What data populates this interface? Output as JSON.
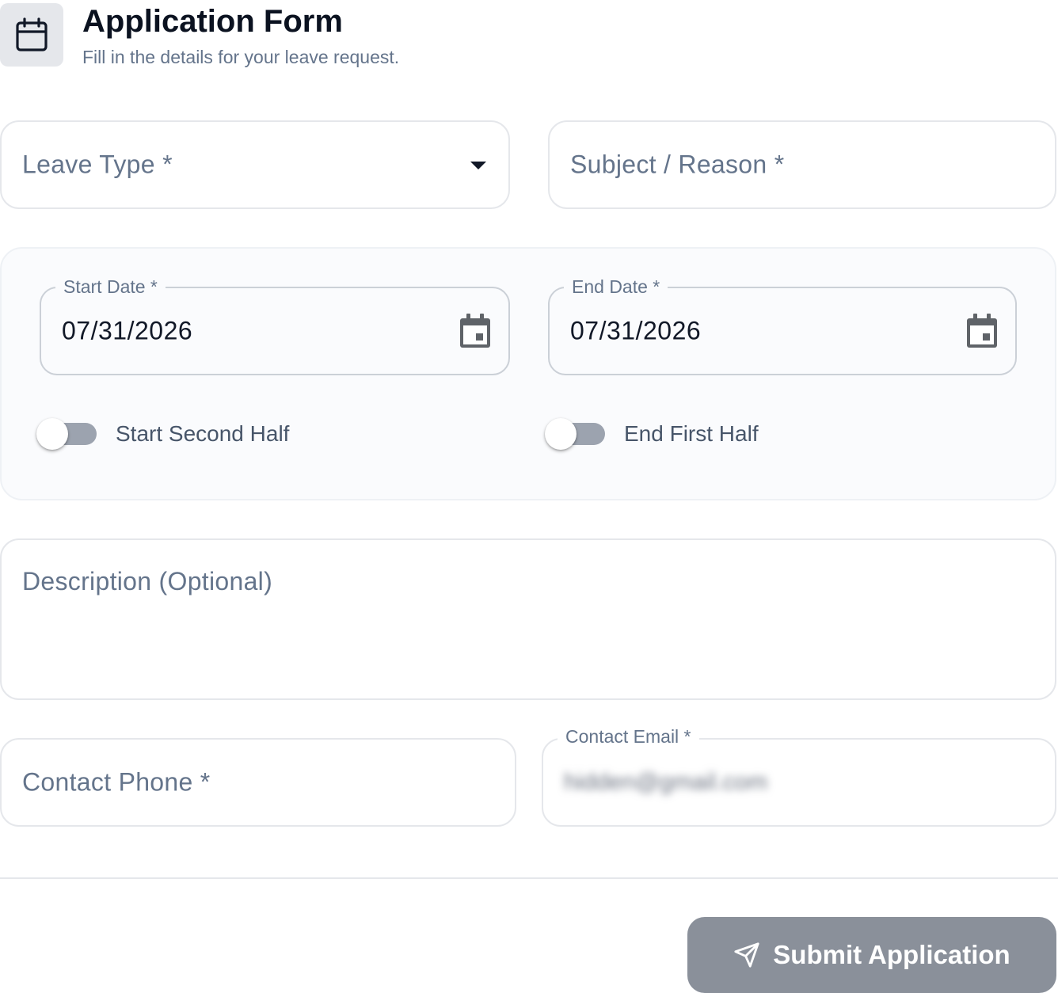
{
  "header": {
    "icon": "calendar-icon",
    "title": "Application Form",
    "subtitle": "Fill in the details for your leave request."
  },
  "leave_type": {
    "label": "Leave Type *",
    "icon": "caret-down-icon"
  },
  "subject": {
    "label": "Subject / Reason *"
  },
  "dates": {
    "start": {
      "label": "Start Date *",
      "value": "07/31/2026",
      "icon": "calendar-icon"
    },
    "end": {
      "label": "End Date *",
      "value": "07/31/2026",
      "icon": "calendar-icon"
    }
  },
  "toggles": {
    "start_second_half": {
      "label": "Start Second Half",
      "checked": false
    },
    "end_first_half": {
      "label": "End First Half",
      "checked": false
    }
  },
  "description": {
    "label": "Description (Optional)"
  },
  "contact_phone": {
    "label": "Contact Phone *"
  },
  "contact_email": {
    "label": "Contact Email *",
    "value": "hidden@gmail.com"
  },
  "submit": {
    "label": "Submit Application",
    "icon": "send-icon"
  },
  "colors": {
    "submit_bg": "#8a909a",
    "toggle_track_off": "#9ca3af",
    "muted_text": "#64748b"
  }
}
